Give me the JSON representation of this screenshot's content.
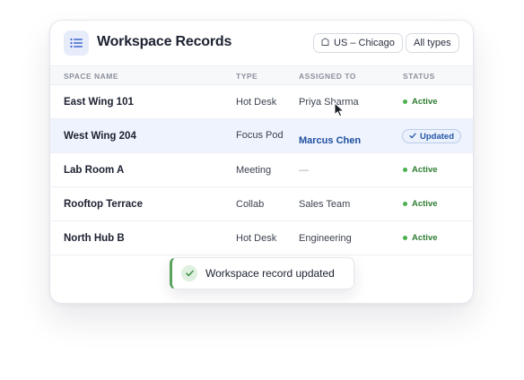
{
  "header": {
    "title": "Workspace Records",
    "icon": "list-icon",
    "location_filter": "US – Chicago",
    "location_icon": "building-icon",
    "type_filter": "All types"
  },
  "table": {
    "columns": [
      "SPACE NAME",
      "TYPE",
      "ASSIGNED TO",
      "STATUS"
    ],
    "rows": [
      {
        "name": "East Wing 101",
        "type": "Hot Desk",
        "assigned": "Priya Sharma",
        "status": "Active"
      },
      {
        "name": "West Wing 204",
        "type": "Focus Pod",
        "assigned": "Marcus Chen",
        "status": "Updated",
        "selected": true
      },
      {
        "name": "Lab Room A",
        "type": "Meeting",
        "assigned": "—",
        "status": "Active"
      },
      {
        "name": "Rooftop Terrace",
        "type": "Collab",
        "assigned": "Sales Team",
        "status": "Active"
      },
      {
        "name": "North Hub B",
        "type": "Hot Desk",
        "assigned": "Engineering",
        "status": "Active"
      }
    ]
  },
  "toast": {
    "message": "Workspace record updated",
    "icon": "check-icon"
  },
  "colors": {
    "accent": "#2456a5",
    "active_green": "#2e7d32",
    "selected_row": "#eef3fd",
    "toast_accent": "#5aa35e"
  }
}
